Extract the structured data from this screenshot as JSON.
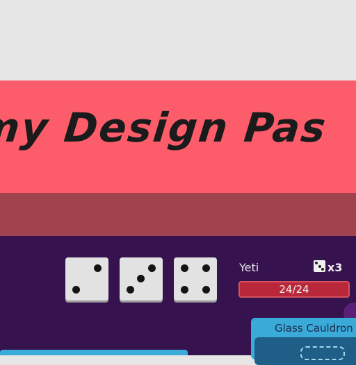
{
  "banner": {
    "title": "my Design Pas"
  },
  "dice": [
    {
      "value": 2
    },
    {
      "value": 3
    },
    {
      "value": 4
    }
  ],
  "enemy": {
    "name": "Yeti",
    "dice_count": "x3",
    "hp_current": 24,
    "hp_max": 24,
    "hp_text": "24/24"
  },
  "item": {
    "title": "Glass Cauldron"
  },
  "colors": {
    "banner": "#fd5d6b",
    "background": "#36124f",
    "hp_fill": "#b9273a",
    "panel": "#3aaad9"
  }
}
